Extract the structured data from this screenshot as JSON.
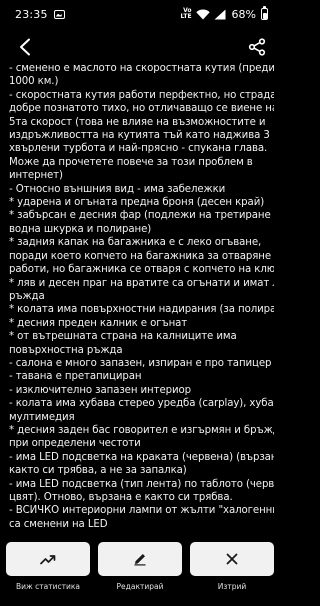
{
  "status_bar": {
    "time": "23:35",
    "network_top": "Vo",
    "network_bottom": "LTE",
    "battery_percent": "68%",
    "battery_level": 0.68,
    "icons": [
      "gallery-icon",
      "wifi-icon",
      "signal-icon",
      "battery-icon"
    ]
  },
  "top_bar": {
    "back_icon": "chevron-left-icon",
    "share_icon": "share-icon"
  },
  "description_lines": [
    "- сменено е маслото на скоростната кутия (преди",
    "1000 км.)",
    "- скоростната кутия работи перфектно, но страда от",
    "добре познатото тихо, но отличаващо се виене на",
    "5та скорост (това не влияе на възможностите и",
    "издръжливостта на кутията тъй като наджива 3",
    "хвърлени турбота и най-прясно - спукана глава.",
    "Може да прочетете повече за този проблем в",
    "интернет)",
    "- Относно външния вид - има забележки",
    "* ударена и огъната предна броня (десен край)",
    "* забърсан е десния фар (подлежи на третиране със",
    "водна шкурка и полиране)",
    "* задния капак на багажника е с леко огъване,",
    "поради което копчето на багажника за отваряне не",
    "работи, но багажника се отваря с копчето на ключа.",
    "* ляв и десен праг на вратите са огънати и имат леко",
    "ръжда",
    "* колата има повърхностни надирания (за полиране е)",
    "* десния преден калник е огънат",
    "* от вътрешната страна на калниците има",
    "повърхностна ръжда",
    "- салона е много запазен, изпиран е про тапицер",
    "- тавана е претапициран",
    "- изключително запазен интериор",
    "- колата има хубава стерео уредба (carplay), хубава",
    "мултимедия",
    "* десния заден бас говорител е изгърмян и бръжди",
    "при определени честоти",
    "- има LED подсветка на краката (червена) (вързана е",
    "както си трябва, а не за запалка)",
    "- има LED подсветка (тип лента) по таблото (червен",
    "цвят). Отново, вързана е както си трябва.",
    "- ВСИЧКО интериорни лампи от жълти \"халогенни\"",
    "са сменени на LED"
  ],
  "actions": [
    {
      "label": "Виж статистика",
      "icon": "trending-up-icon"
    },
    {
      "label": "Редактирай",
      "icon": "edit-pencil-icon"
    },
    {
      "label": "Изтрий",
      "icon": "delete-x-icon"
    }
  ],
  "colors": {
    "background": "#000000",
    "text": "#f2f2f2",
    "button_bg": "#f1f1f1",
    "icon_dark": "#1a1a1a"
  }
}
